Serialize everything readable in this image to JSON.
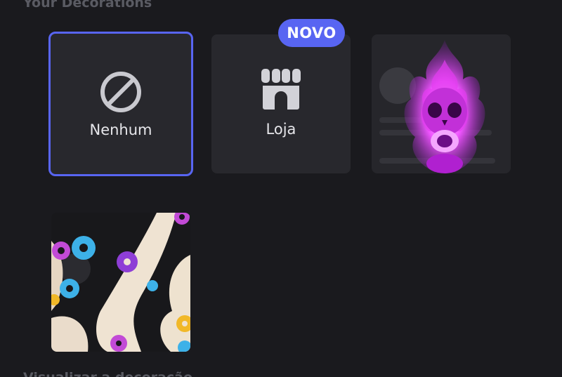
{
  "section": {
    "title": "Your Decorations",
    "next_title": "Visualizar a decoração"
  },
  "tiles": [
    {
      "label": "Nenhum",
      "icon": "no-symbol-icon",
      "selected": true
    },
    {
      "label": "Loja",
      "icon": "shop-icon",
      "badge": "NOVO"
    },
    {
      "label": "",
      "icon": "purple-flame-skull-decoration"
    },
    {
      "label": "",
      "icon": "donut-glaze-decoration"
    }
  ],
  "colors": {
    "background": "#1a1a1e",
    "tile": "#28282d",
    "accent": "#5865f2",
    "section_title": "#5a5b63",
    "label": "#e6e6ea"
  }
}
